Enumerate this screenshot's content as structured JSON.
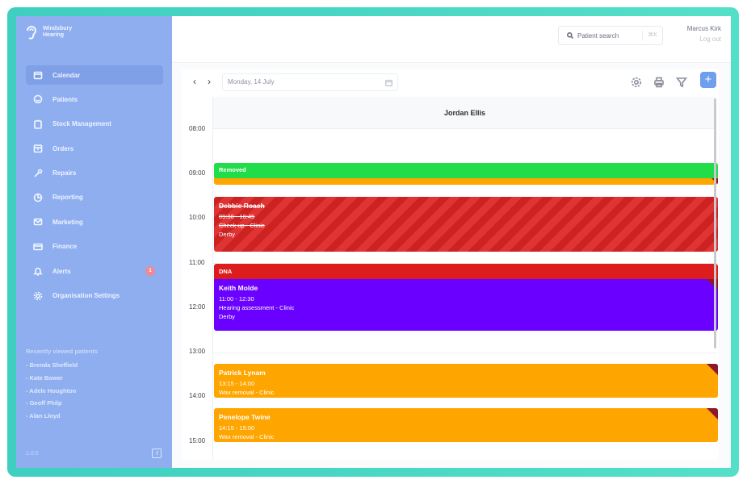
{
  "brand": {
    "line1": "Windsbury",
    "line2": "Hearing"
  },
  "sidebar": {
    "items": [
      {
        "label": "Calendar",
        "icon": "calendar-icon",
        "active": true
      },
      {
        "label": "Patients",
        "icon": "smile-icon"
      },
      {
        "label": "Stock Management",
        "icon": "clipboard-icon"
      },
      {
        "label": "Orders",
        "icon": "box-icon"
      },
      {
        "label": "Repairs",
        "icon": "wrench-icon"
      },
      {
        "label": "Reporting",
        "icon": "chart-pie-icon"
      },
      {
        "label": "Marketing",
        "icon": "mail-icon"
      },
      {
        "label": "Finance",
        "icon": "card-icon"
      },
      {
        "label": "Alerts",
        "icon": "bell-icon",
        "badge": "1"
      },
      {
        "label": "Organisation Settings",
        "icon": "gear-icon"
      }
    ],
    "recent_title": "Recently viewed patients",
    "recent": [
      "- Brenda Sheffield",
      "- Kate Bower",
      "- Adele Houghton",
      "- Geoff Philp",
      "- Alan Lloyd"
    ],
    "version": "1.0.0"
  },
  "topbar": {
    "search_label": "Patient search",
    "search_shortcut": "⌘K",
    "user_name": "Marcus Kirk",
    "logout": "Log out"
  },
  "calendar": {
    "date": "Monday, 14 July",
    "column_title": "Jordan Ellis",
    "times": [
      "08:00",
      "09:00",
      "10:00",
      "11:00",
      "12:00",
      "13:00",
      "14:00",
      "15:00"
    ],
    "events": [
      {
        "tag": "Removed",
        "tag_color": "#22dd4a",
        "color": "#ffa500",
        "name": "",
        "time": "",
        "type": "",
        "location": ""
      },
      {
        "name": "Debbie Roach",
        "time": "09:30 - 10:45",
        "type": "Check up - Clinic",
        "location": "Derby",
        "color": "#cc2222",
        "striped": true
      },
      {
        "tag": "DNA",
        "tag_color": "#dd1d1d",
        "name": "Keith Molde",
        "time": "11:00 - 12:30",
        "type": "Hearing assessment - Clinic",
        "location": "Derby",
        "color": "#6a00ff"
      },
      {
        "name": "Patrick Lynam",
        "time": "13:15 - 14:00",
        "type": "Wax removal - Clinic",
        "location": "",
        "color": "#ffa500"
      },
      {
        "name": "Penelope Twine",
        "time": "14:15 - 15:00",
        "type": "Wax removal - Clinic",
        "location": "",
        "color": "#ffa500"
      }
    ]
  },
  "colors": {
    "accent": "#6f9eed",
    "sidebar": "#8eaef0",
    "frame": "#3ecfc0"
  }
}
